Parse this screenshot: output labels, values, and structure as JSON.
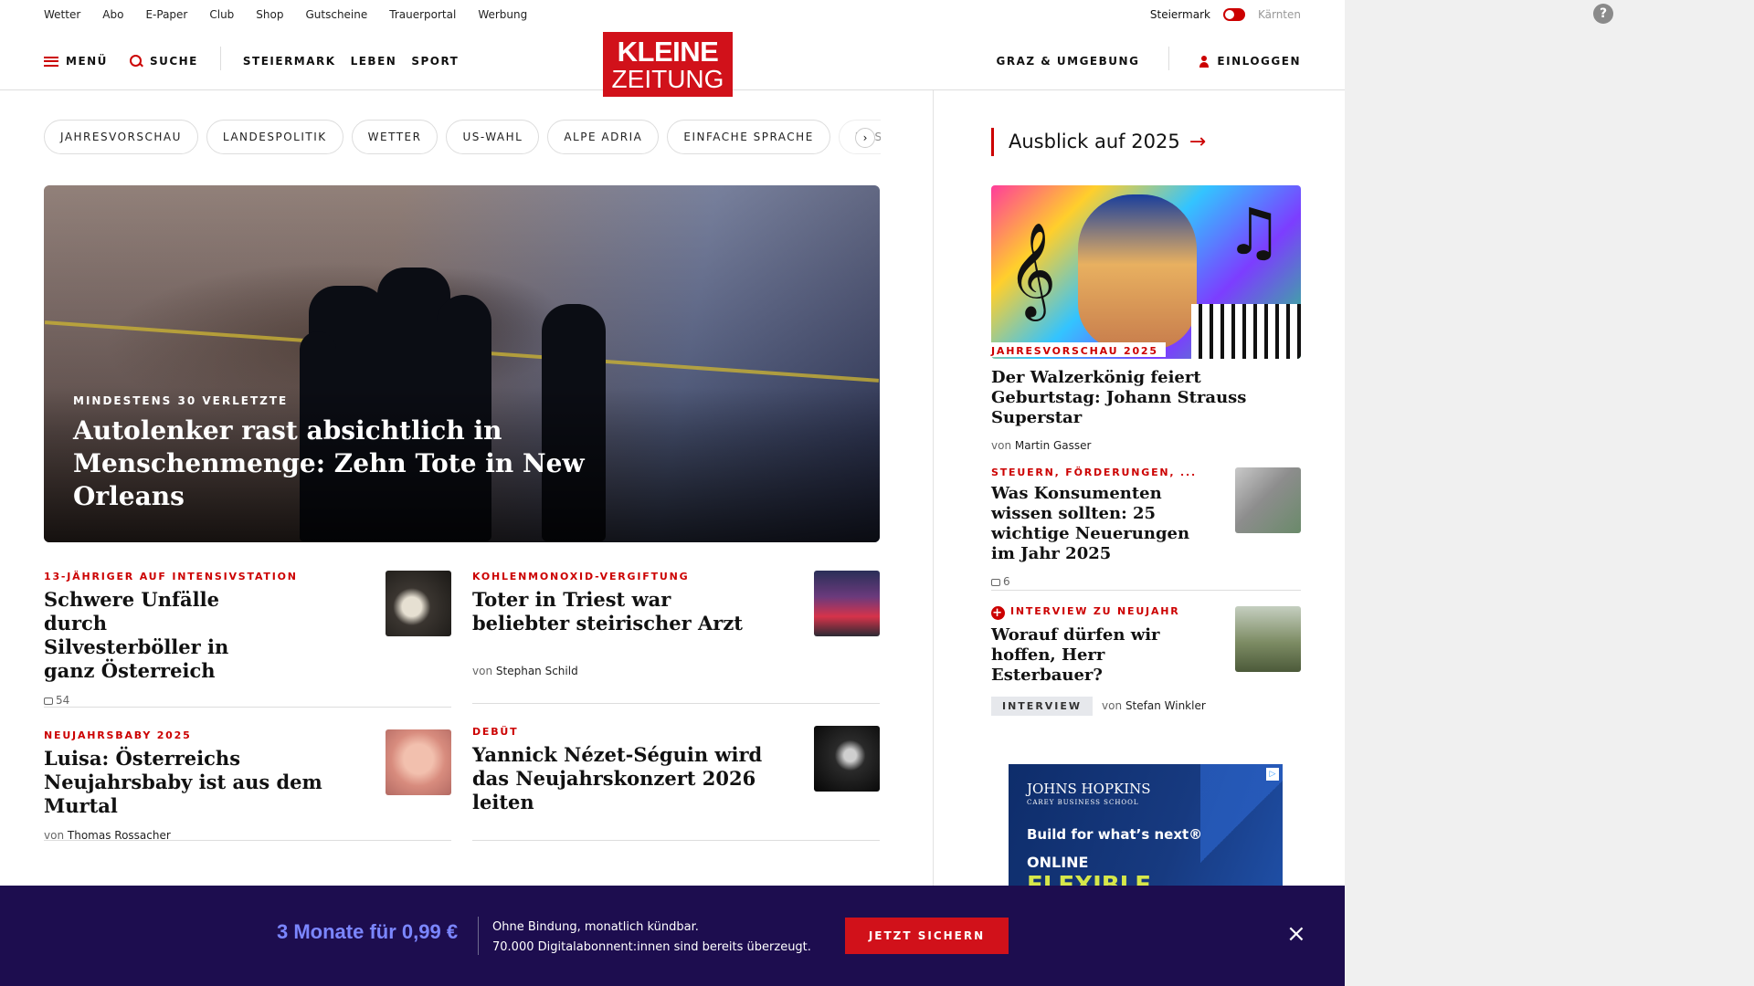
{
  "util": {
    "links": [
      "Wetter",
      "Abo",
      "E-Paper",
      "Club",
      "Shop",
      "Gutscheine",
      "Trauerportal",
      "Werbung"
    ],
    "region_left": "Steiermark",
    "region_right": "Kärnten"
  },
  "header": {
    "menu": "MENÜ",
    "search": "SUCHE",
    "nav": [
      "STEIERMARK",
      "LEBEN",
      "SPORT"
    ],
    "logo_line1": "KLEINE",
    "logo_line2": "ZEITUNG",
    "region": "GRAZ & UMGEBUNG",
    "login": "EINLOGGEN"
  },
  "topics": [
    "JAHRESVORSCHAU",
    "LANDESPOLITIK",
    "WETTER",
    "US-WAHL",
    "ALPE ADRIA",
    "EINFACHE SPRACHE",
    "DOSSIERS"
  ],
  "hero": {
    "kicker": "MINDESTENS 30 VERLETZTE",
    "title": "Autolenker rast absichtlich in Menschenmenge: Zehn Tote in New Orleans"
  },
  "cards": [
    {
      "kicker": "13-JÄHRIGER AUF INTENSIVSTATION",
      "title": "Schwere Unfälle durch Silvesterböller in ganz Österreich",
      "comments": "54"
    },
    {
      "kicker": "KOHLENMONOXID-VERGIFTUNG",
      "title": "Toter in Triest war beliebter steirischer Arzt",
      "by": "von",
      "author": "Stephan Schild"
    },
    {
      "kicker": "NEUJAHRSBABY 2025",
      "title": "Luisa: Österreichs Neujahrsbaby ist aus dem Murtal",
      "by": "von",
      "author": "Thomas Rossacher"
    },
    {
      "kicker": "DEBÜT",
      "title": "Yannick Nézet-Séguin wird das Neujahrskonzert 2026 leiten"
    }
  ],
  "sidebar": {
    "heading": "Ausblick auf 2025",
    "feature": {
      "kicker": "JAHRESVORSCHAU 2025",
      "title": "Der Walzerkönig feiert Geburtstag: Johann Strauss Superstar",
      "by": "von",
      "author": "Martin Gasser"
    },
    "item1": {
      "kicker": "STEUERN, FÖRDERUNGEN, ...",
      "title": "Was Konsumenten wissen sollten: 25 wichtige Neuerungen im Jahr 2025",
      "comments": "6"
    },
    "item2": {
      "kicker": "INTERVIEW ZU NEUJAHR",
      "title": "Worauf dürfen wir hoffen, Herr Esterbauer?",
      "tag": "INTERVIEW",
      "by": "von",
      "author": "Stefan Winkler"
    }
  },
  "ad": {
    "logo": "JOHNS HOPKINS",
    "logo_sub": "CAREY BUSINESS SCHOOL",
    "tagline": "Build for what’s next®",
    "line1": "ONLINE",
    "line2": "FLEXIBLE"
  },
  "banner": {
    "price": "3 Monate für 0,99 €",
    "line1": "Ohne Bindung, monatlich kündbar.",
    "line2": "70.000 Digitalabonnent:innen sind bereits überzeugt.",
    "button": "JETZT SICHERN",
    "close": "×"
  },
  "colors": {
    "brand_red": "#d1111a",
    "banner_bg": "#1d0d4f",
    "banner_price": "#7b86ff"
  }
}
